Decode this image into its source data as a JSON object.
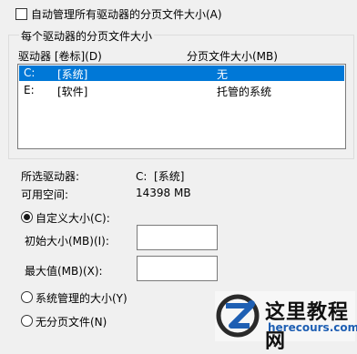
{
  "auto_manage": {
    "checkbox_label": "自动管理所有驱动器的分页文件大小(A)",
    "checked": false
  },
  "group": {
    "title": "每个驱动器的分页文件大小",
    "list": {
      "headers": {
        "drive": "驱动器 [卷标](D)",
        "size": "分页文件大小(MB)"
      },
      "rows": [
        {
          "drive": "C:",
          "label": "[系统]",
          "size": "无",
          "selected": true
        },
        {
          "drive": "E:",
          "label": "[软件]",
          "size": "托管的系统",
          "selected": false
        }
      ]
    }
  },
  "info": {
    "selected_drive_label": "所选驱动器:",
    "selected_drive_value": "C:  [系统]",
    "free_space_label": "可用空间:",
    "free_space_value": "14398 MB"
  },
  "options": {
    "custom_size": {
      "label": "自定义大小(C):",
      "checked": true
    },
    "initial_size": {
      "label": "初始大小(MB)(I):",
      "value": ""
    },
    "max_size": {
      "label": "最大值(MB)(X):",
      "value": ""
    },
    "system_managed": {
      "label": "系统管理的大小(Y)",
      "checked": false
    },
    "no_paging": {
      "label": "无分页文件(N)",
      "checked": false
    }
  },
  "watermark": {
    "title": "这里教程网",
    "url": "herecours.com",
    "accent_color": "#1e5fb3"
  }
}
